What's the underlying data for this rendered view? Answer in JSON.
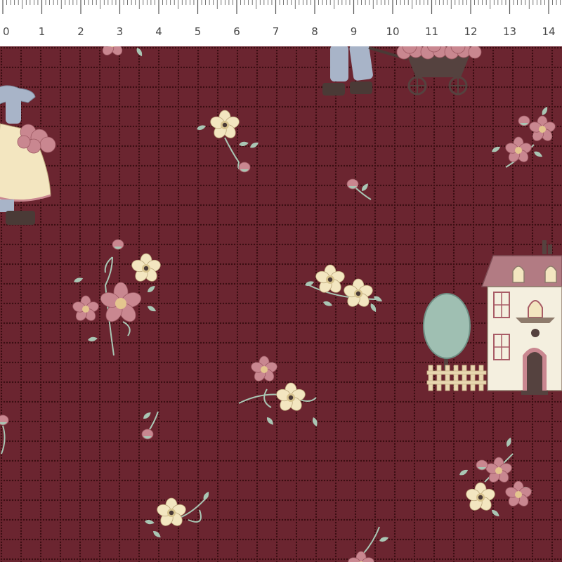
{
  "ruler": {
    "unit": "cm",
    "labels": [
      "0",
      "1",
      "2",
      "3",
      "4",
      "5",
      "6",
      "7",
      "8",
      "9",
      "10",
      "11",
      "12",
      "13",
      "14"
    ]
  },
  "fabric": {
    "colors": {
      "background": "#6b2530",
      "grid_dots": "#3a0d12",
      "cream": "#f3e6c0",
      "pink": "#c98790",
      "dark_pink": "#a85c66",
      "sage": "#a9c6b4",
      "house_wall": "#f4efdf",
      "roof": "#b27b83",
      "tree": "#9fbfb2",
      "blue_grey": "#a8b4c8"
    },
    "motifs": [
      "flower-sprig",
      "bonnet-girl",
      "boy-with-cart",
      "house",
      "tree",
      "fence"
    ]
  }
}
